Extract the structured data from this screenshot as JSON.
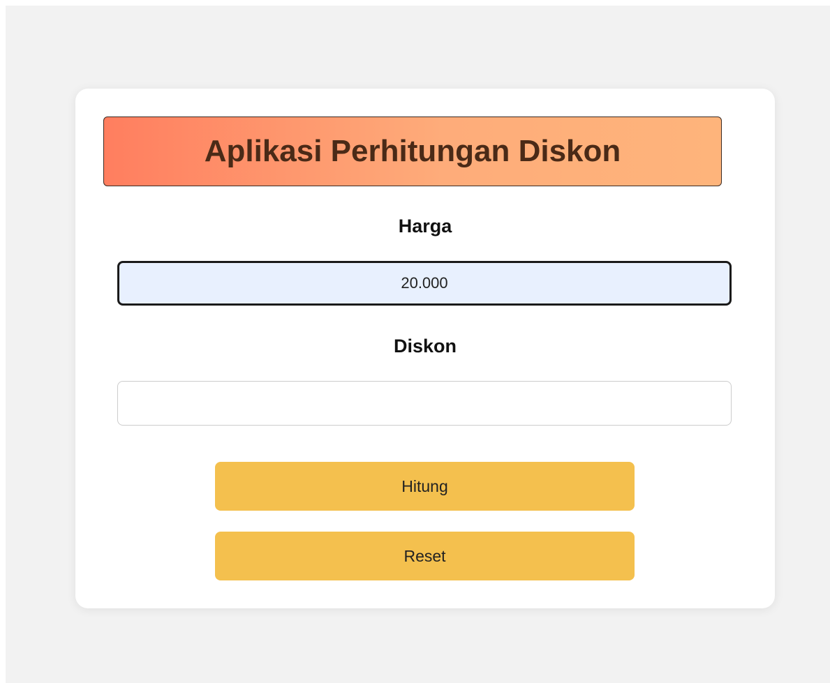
{
  "app": {
    "title": "Aplikasi Perhitungan Diskon"
  },
  "form": {
    "harga": {
      "label": "Harga",
      "value": "20.000",
      "placeholder": ""
    },
    "diskon": {
      "label": "Diskon",
      "value": "",
      "placeholder": ""
    }
  },
  "buttons": {
    "hitung_label": "Hitung",
    "reset_label": "Reset"
  },
  "colors": {
    "page_background": "#f2f2f2",
    "title_gradient_start": "#ff7e5f",
    "title_gradient_end": "#feb47b",
    "title_text": "#4a2a17",
    "button_background": "#f4c04e",
    "harga_input_background": "#e8f0fe"
  }
}
